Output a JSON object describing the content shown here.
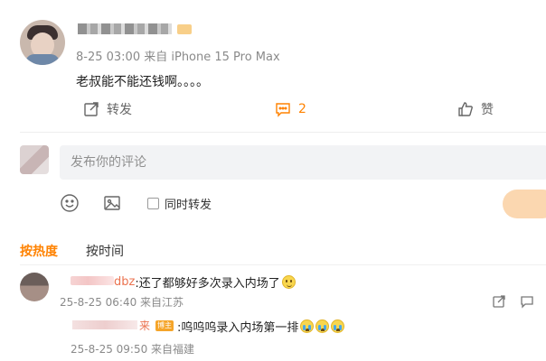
{
  "post": {
    "meta": "8-25 03:00  来自 iPhone 15 Pro Max",
    "text": "老叔能不能还钱啊。。。。",
    "actions": {
      "repost_label": "转发",
      "comment_count": "2",
      "like_label": "赞"
    }
  },
  "composer": {
    "placeholder": "发布你的评论",
    "same_repost_label": "同时转发"
  },
  "sort": {
    "hot_label": "按热度",
    "time_label": "按时间"
  },
  "comments": [
    {
      "name_suffix": "dbz",
      "text": ":还了都够好多次录入内场了",
      "time": "25-8-25 06:40 来自江苏",
      "emoji": "smile-emoji",
      "reply": {
        "name_suffix": "来",
        "badge": "博主",
        "text": ":呜呜呜录入内场第一排",
        "time": "25-8-25 09:50 来自福建",
        "emoji": "cry-emoji"
      }
    }
  ],
  "colors": {
    "accent": "#ff8200",
    "send_button": "#fbd7b0",
    "input_bg": "#f2f3f5"
  }
}
